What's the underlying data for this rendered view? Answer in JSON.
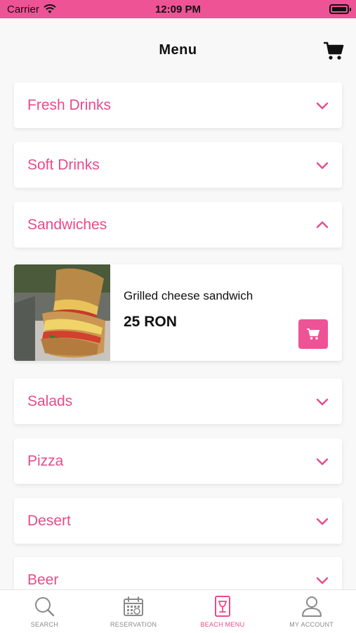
{
  "status": {
    "carrier": "Carrier",
    "time": "12:09 PM"
  },
  "header": {
    "title": "Menu"
  },
  "categories": [
    {
      "label": "Fresh Drinks",
      "expanded": false
    },
    {
      "label": "Soft Drinks",
      "expanded": false
    },
    {
      "label": "Sandwiches",
      "expanded": true
    },
    {
      "label": "Salads",
      "expanded": false
    },
    {
      "label": "Pizza",
      "expanded": false
    },
    {
      "label": "Desert",
      "expanded": false
    },
    {
      "label": "Beer",
      "expanded": false
    }
  ],
  "item": {
    "name": "Grilled cheese sandwich",
    "price": "25 RON"
  },
  "tabs": [
    {
      "label": "SEARCH",
      "icon": "search-icon"
    },
    {
      "label": "RESERVATION",
      "icon": "calendar-icon"
    },
    {
      "label": "BEACH MENU",
      "icon": "menu-glass-icon",
      "active": true
    },
    {
      "label": "MY ACCOUNT",
      "icon": "user-icon"
    }
  ],
  "colors": {
    "accent": "#ee5396",
    "label": "#e84b8a"
  }
}
